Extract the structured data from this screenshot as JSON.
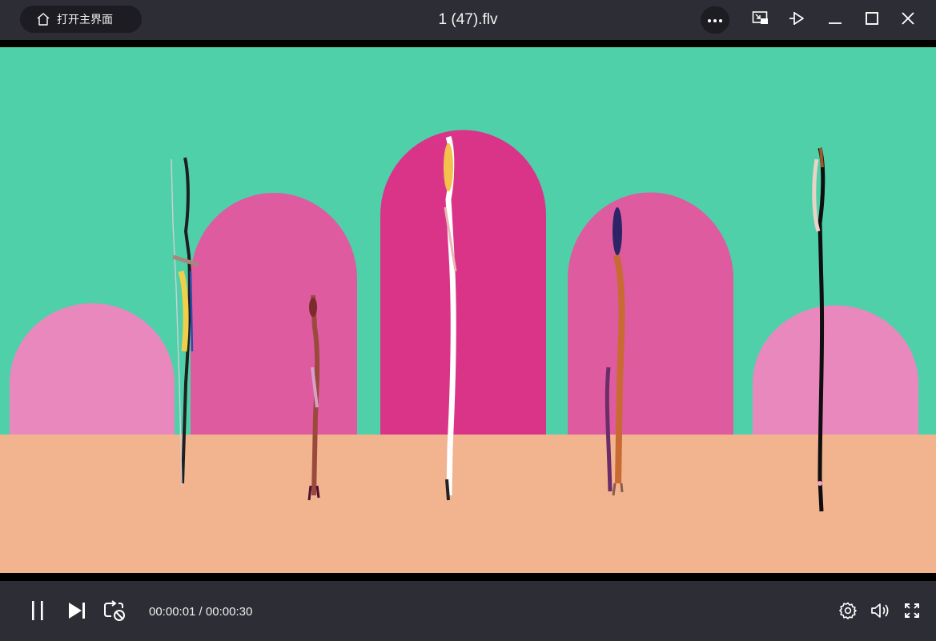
{
  "titlebar": {
    "home_label": "打开主界面",
    "file_title": "1 (47).flv"
  },
  "icons": {
    "home": "home-icon",
    "more": "more-dots-icon",
    "pip": "picture-in-picture-icon",
    "pin": "pin-icon",
    "minimize": "minimize-icon",
    "maximize": "maximize-icon",
    "close": "close-icon",
    "pause": "pause-icon",
    "next": "next-track-icon",
    "loop": "loop-timer-icon",
    "settings": "settings-gear-icon",
    "volume": "volume-icon",
    "fullscreen": "fullscreen-icon"
  },
  "playback": {
    "current_time": "00:00:01",
    "separator": " / ",
    "duration": "00:00:30"
  },
  "colors": {
    "chrome": "#2c2d35",
    "pill": "#1c1c22",
    "video_sky": "#4fd0a8",
    "video_floor": "#f2b38f",
    "arch_light": "#e988bd",
    "arch_mid": "#de5ba0",
    "arch_center": "#da3489"
  }
}
